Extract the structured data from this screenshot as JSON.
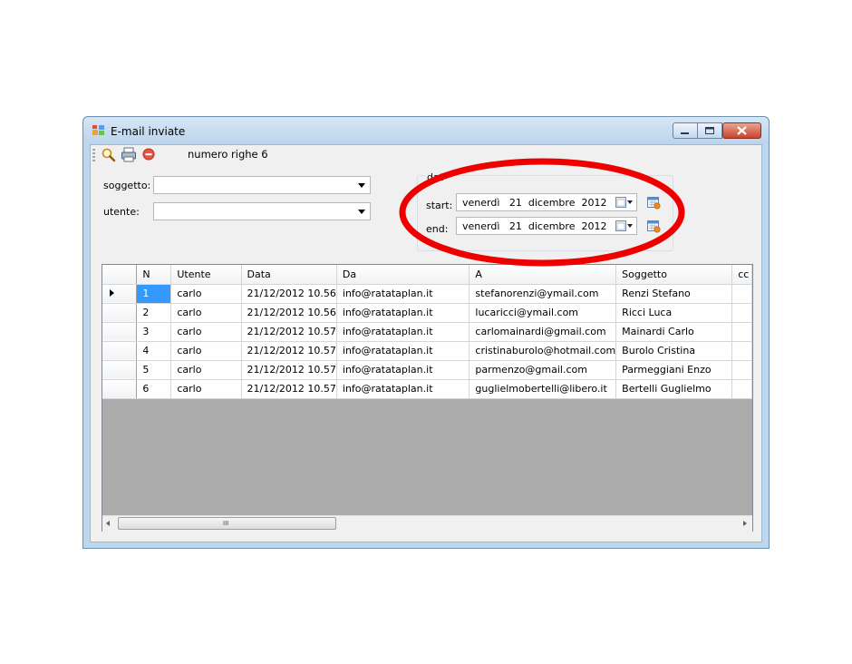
{
  "window": {
    "title": "E-mail inviate"
  },
  "toolbar": {
    "search_icon": "search-icon",
    "print_icon": "printer-icon",
    "cancel_icon": "stop-icon",
    "count_label": "numero righe 6"
  },
  "filters": {
    "soggetto_label": "soggetto:",
    "soggetto_value": "",
    "utente_label": "utente:",
    "utente_value": ""
  },
  "date_group": {
    "legend": "dat",
    "start_label": "start:",
    "start_value": "venerdì   21  dicembre  2012",
    "end_label": "end:",
    "end_value": "venerdì   21  dicembre  2012"
  },
  "grid": {
    "columns": [
      "N",
      "Utente",
      "Data",
      "Da",
      "A",
      "Soggetto",
      "cc"
    ],
    "rows": [
      [
        "1",
        "carlo",
        "21/12/2012 10.56",
        "info@ratataplan.it",
        "stefanorenzi@ymail.com",
        "Renzi Stefano",
        ""
      ],
      [
        "2",
        "carlo",
        "21/12/2012 10.56",
        "info@ratataplan.it",
        "lucaricci@ymail.com",
        "Ricci Luca",
        ""
      ],
      [
        "3",
        "carlo",
        "21/12/2012 10.57",
        "info@ratataplan.it",
        "carlomainardi@gmail.com",
        "Mainardi Carlo",
        ""
      ],
      [
        "4",
        "carlo",
        "21/12/2012 10.57",
        "info@ratataplan.it",
        "cristinaburolo@hotmail.com",
        "Burolo Cristina",
        ""
      ],
      [
        "5",
        "carlo",
        "21/12/2012 10.57",
        "info@ratataplan.it",
        "parmenzo@gmail.com",
        "Parmeggiani Enzo",
        ""
      ],
      [
        "6",
        "carlo",
        "21/12/2012 10.57",
        "info@ratataplan.it",
        "guglielmobertelli@libero.it",
        "Bertelli Guglielmo",
        ""
      ]
    ],
    "scroll_grip": "III"
  },
  "colors": {
    "annotation": "#ee0000",
    "selection": "#3399ff",
    "grid_empty": "#ababab"
  }
}
